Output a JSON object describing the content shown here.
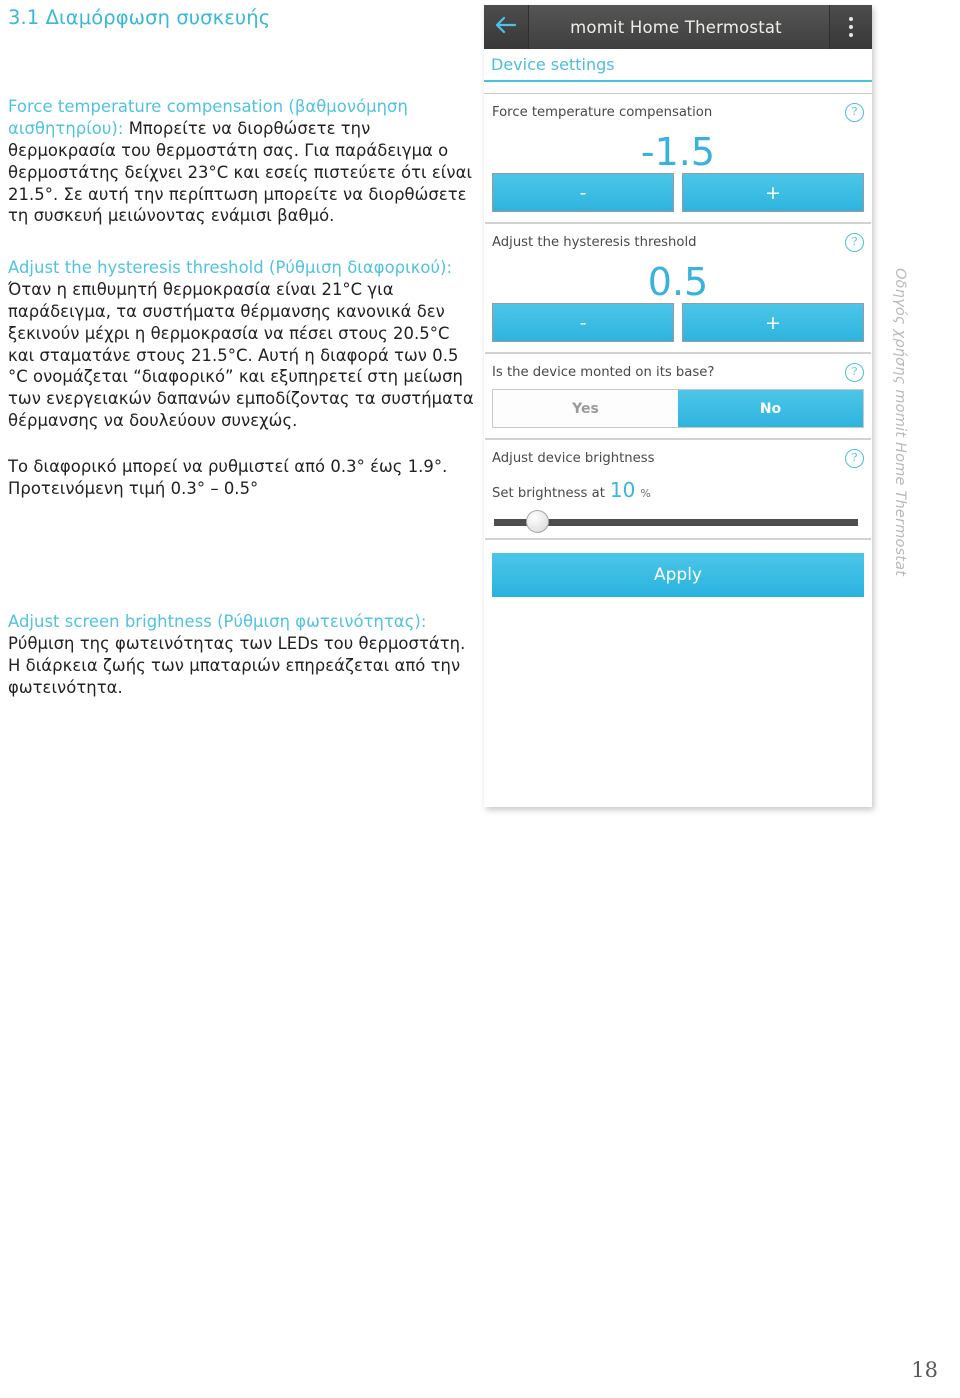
{
  "document": {
    "section_heading": "3.1 Διαμόρφωση συσκευής",
    "page_number": "18",
    "running_head": "Οδηγός χρήσης momit Home Thermostat",
    "accent_color": "#4fc3e0",
    "body_color": "#231f20"
  },
  "paragraphs": [
    {
      "lead": "Force temperature compensation (βαθμονόμηση αισθητηρίου):",
      "body": " Μπορείτε να διορθώσετε την θερμοκρασία του θερμοστάτη σας. Για παράδειγμα ο θερμοστάτης δείχνει 23°C και εσείς πιστεύετε ότι είναι 21.5°. Σε αυτή την περίπτωση μπορείτε να διορθώσετε τη συσκευή μειώνοντας ενάμισι βαθμό."
    },
    {
      "lead": "Adjust the hysteresis threshold (Ρύθμιση διαφορικού):",
      "body": " Όταν η επιθυμητή θερμοκρασία είναι 21°C για παράδειγμα,  τα συστήματα θέρμανσης κανονικά δεν ξεκινούν μέχρι η θερμοκρασία να πέσει στους 20.5°C και σταματάνε στους 21.5°C.  Αυτή η διαφορά των 0.5 °C ονομάζεται “διαφορικό”  και εξυπηρετεί στη μείωση των ενεργειακών δαπανών εμποδίζοντας τα συστήματα θέρμανσης να δουλεύουν συνεχώς."
    },
    {
      "lead": "",
      "body": "Το διαφορικό μπορεί να ρυθμιστεί από 0.3° έως 1.9°. Προτεινόμενη τιμή 0.3° – 0.5°"
    },
    {
      "lead": "Adjust screen brightness (Ρύθμιση φωτεινότητας):",
      "body": " Ρύθμιση της φωτεινότητας των LEDs του θερμοστάτη. Η διάρκεια ζωής των μπαταριών επηρεάζεται από την φωτεινότητα."
    }
  ],
  "app": {
    "title": "momit Home Thermostat",
    "back_icon": "back-arrow-icon",
    "overflow_icon": "overflow-menu-icon",
    "subtitle": "Device settings",
    "help_icon_glyph": "?",
    "settings": {
      "compensation": {
        "label": "Force temperature compensation",
        "value": "-1.5",
        "minus_label": "-",
        "plus_label": "+"
      },
      "hysteresis": {
        "label": "Adjust the hysteresis threshold",
        "value": "0.5",
        "minus_label": "-",
        "plus_label": "+"
      },
      "base_mount": {
        "label": "Is the device monted on its base?",
        "option_yes": "Yes",
        "option_no": "No",
        "selected": "No"
      },
      "brightness": {
        "label": "Adjust device brightness",
        "slider_prefix": "Set brightness at",
        "value": "10",
        "unit": "%",
        "slider_percent": 10
      }
    },
    "apply_label": "Apply"
  }
}
